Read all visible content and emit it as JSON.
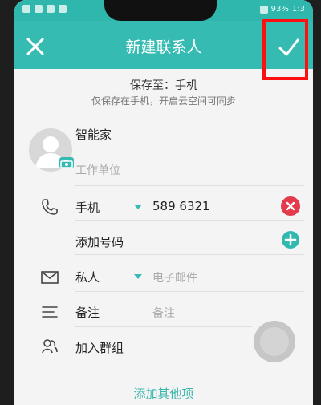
{
  "status": {
    "battery": "93%",
    "time": "1:3"
  },
  "appbar": {
    "title": "新建联系人"
  },
  "save": {
    "label": "保存至：手机",
    "sync_note": "仅保存在手机，开启云空间可同步"
  },
  "contact": {
    "name": "智能家",
    "company_placeholder": "工作单位",
    "phone_type": "手机",
    "phone_number": "589 6321",
    "add_number": "添加号码",
    "email_type": "私人",
    "email_placeholder": "电子邮件",
    "note_label": "备注",
    "note_placeholder": "备注",
    "group_label": "加入群组",
    "add_more": "添加其他项"
  },
  "icons": [
    "close-icon",
    "check-icon",
    "camera-icon",
    "phone-icon",
    "mail-icon",
    "note-icon",
    "group-icon",
    "remove-icon",
    "add-icon"
  ],
  "colors": {
    "accent": "#36bbb2",
    "remove": "#e5394c",
    "highlight": "#ff1010"
  }
}
